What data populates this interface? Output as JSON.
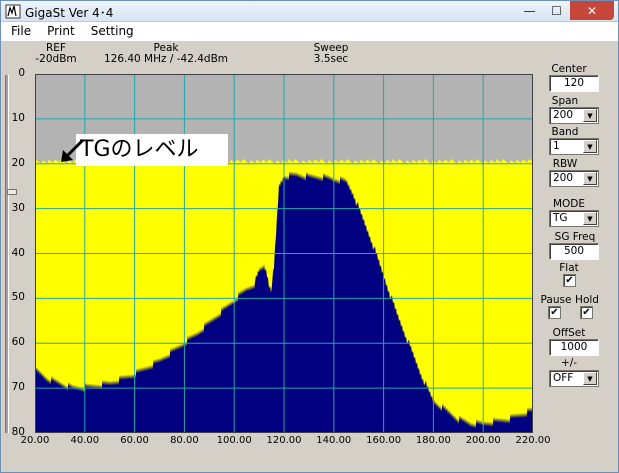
{
  "window": {
    "title": "GigaSt Ver 4･4",
    "buttons": {
      "minimize": "—",
      "maximize": "☐",
      "close": "✕"
    }
  },
  "menu": [
    "File",
    "Print",
    "Setting"
  ],
  "header": {
    "ref_label": "REF",
    "ref_value": "-20dBm",
    "peak_label": "Peak",
    "peak_value": "126.40 MHz / -42.4dBm",
    "sweep_label": "Sweep",
    "sweep_value": "3.5sec"
  },
  "annotation": {
    "text": "TGのレベル",
    "arrow_icon": "arrow-down-left-icon"
  },
  "controls": {
    "center_label": "Center",
    "center_value": "120",
    "span_label": "Span",
    "span_value": "200",
    "band_label": "Band",
    "band_value": "1",
    "rbw_label": "RBW",
    "rbw_value": "200",
    "mode_label": "MODE",
    "mode_value": "TG",
    "sg_freq_label": "SG Freq",
    "sg_freq_value": "500",
    "flat_label": "Flat",
    "flat_checked": true,
    "pause_label": "Pause",
    "pause_checked": true,
    "hold_label": "Hold",
    "hold_checked": true,
    "offset_label": "OffSet",
    "offset_value": "1000",
    "sign_label": "+/-",
    "sign_value": "OFF",
    "check_mark": "✔",
    "dropdown_arrow": "▼"
  },
  "colors": {
    "plot_background": "#b3b3b3",
    "grid": "#1fa8a8",
    "tg_trace": "#ffff00",
    "signal_trace": "#000080",
    "titlebar": "#dbe6f3"
  },
  "chart_data": {
    "type": "area",
    "xlim": [
      20,
      220
    ],
    "ylim": [
      0,
      80
    ],
    "y_inverted": true,
    "y_unit_note": "",
    "xticks": [
      "20.00",
      "40.00",
      "60.00",
      "80.00",
      "100.00",
      "120.00",
      "140.00",
      "160.00",
      "180.00",
      "200.00",
      "220.00"
    ],
    "yticks": [
      "0",
      "10",
      "20",
      "30",
      "40",
      "50",
      "60",
      "70",
      "80"
    ],
    "grid": true,
    "series": [
      {
        "name": "",
        "color": "#ffff00",
        "x": [
          20,
          220
        ],
        "y": [
          19.5,
          19.5
        ]
      },
      {
        "name": "",
        "color": "#000080",
        "x": [
          20,
          25,
          30,
          35,
          40,
          45,
          50,
          55,
          60,
          65,
          70,
          75,
          80,
          85,
          90,
          95,
          100,
          105,
          108,
          110,
          112,
          113,
          114,
          115,
          116,
          118,
          120,
          125,
          130,
          135,
          140,
          145,
          148,
          150,
          155,
          160,
          165,
          170,
          175,
          180,
          185,
          190,
          195,
          200,
          205,
          210,
          215,
          220
        ],
        "y": [
          66,
          68,
          69,
          70,
          70,
          69.5,
          69,
          68,
          67,
          65.5,
          64,
          62,
          60,
          58,
          55.5,
          53,
          50.5,
          48,
          47,
          44,
          43,
          44,
          47,
          48,
          43,
          25,
          23,
          22.5,
          23,
          23,
          23.5,
          24,
          27,
          30,
          37,
          45,
          53,
          60,
          67,
          73,
          75,
          77,
          78,
          78,
          77.5,
          77,
          76,
          75
        ]
      }
    ]
  }
}
